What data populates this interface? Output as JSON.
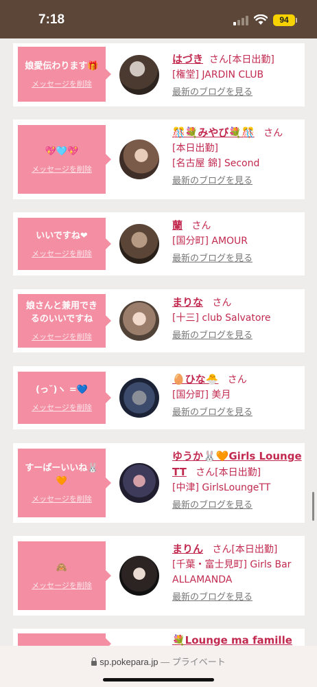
{
  "status": {
    "time": "7:18",
    "battery": "94"
  },
  "cards": [
    {
      "message": "娘愛伝わります🎁",
      "delete_label": "メッセージを削除",
      "name": "はづき",
      "san": "さん",
      "shift": "[本日出勤]",
      "shop": "[権堂] JARDIN CLUB",
      "blog": "最新のブログを見る"
    },
    {
      "message": "💖🩵💖",
      "delete_label": "メッセージを削除",
      "name": "🎊💐みやび💐🎊",
      "san": "さん",
      "shift": "[本日出勤]",
      "shop": "[名古屋 錦] Second",
      "blog": "最新のブログを見る"
    },
    {
      "message": "いいですね❤",
      "delete_label": "メッセージを削除",
      "name": "蘭",
      "san": "さん",
      "shift": "",
      "shop": "[国分町] AMOUR",
      "blog": "最新のブログを見る"
    },
    {
      "message": "娘さんと兼用できるのいいですね",
      "delete_label": "メッセージを削除",
      "name": "まりな",
      "san": "さん",
      "shift": "",
      "shop": "[十三] club Salvatore",
      "blog": "最新のブログを見る"
    },
    {
      "message": "(っ˘)ヽ =💙",
      "delete_label": "メッセージを削除",
      "name": "🥚ひな🐣",
      "san": "さん",
      "shift": "",
      "shop": "[国分町] 美月",
      "blog": "最新のブログを見る"
    },
    {
      "message": "すーぱーいいね🐰🧡",
      "delete_label": "メッセージを削除",
      "name": "ゆうか🐰🧡Girls Lounge TT",
      "san": "さん",
      "shift": "[本日出勤]",
      "shop": "[中津] GirlsLoungeTT",
      "blog": "最新のブログを見る"
    },
    {
      "message": "🙈",
      "delete_label": "メッセージを削除",
      "name": "まりん",
      "san": "さん",
      "shift": "[本日出勤]",
      "shop": "[千葉・富士見町] Girls Bar ALLAMANDA",
      "blog": "最新のブログを見る"
    },
    {
      "message": "",
      "delete_label": "",
      "name": "💐Lounge ma famille💐",
      "san": "",
      "shift": "",
      "shop": "",
      "blog": ""
    }
  ],
  "browser": {
    "domain": "sp.pokepara.jp",
    "separator": "—",
    "mode": "プライベート"
  }
}
